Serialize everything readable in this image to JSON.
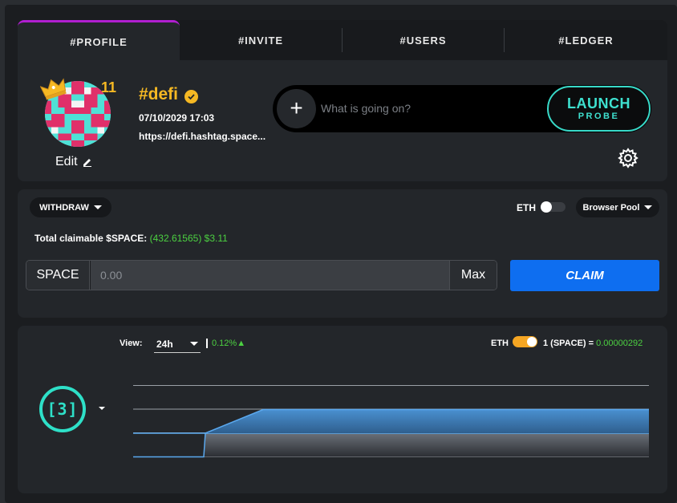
{
  "tabs": [
    {
      "label": "#PROFILE",
      "active": true
    },
    {
      "label": "#INVITE",
      "active": false
    },
    {
      "label": "#USERS",
      "active": false
    },
    {
      "label": "#LEDGER",
      "active": false
    }
  ],
  "profile": {
    "level": "11",
    "edit_label": "Edit",
    "username": "#defi",
    "date": "07/10/2029 17:03",
    "url": "https://defi.hashtag.space..."
  },
  "composer": {
    "placeholder": "What is going on?",
    "plus_label": "+",
    "launch_main": "LAUNCH",
    "launch_sub": "PROBE"
  },
  "claim": {
    "withdraw_label": "WITHDRAW",
    "eth_label": "ETH",
    "pool_label": "Browser Pool",
    "claimable_label": "Total claimable $SPACE:",
    "claimable_amount": "(432.61565)",
    "claimable_usd": "$3.11",
    "currency_label": "SPACE",
    "amount_placeholder": "0.00",
    "max_label": "Max",
    "claim_label": "CLAIM"
  },
  "chart": {
    "view_label": "View:",
    "view_value": "24h",
    "change_pct": "0.12%▲",
    "eth_label": "ETH",
    "rate_label": "1 (SPACE) =",
    "rate_value": "0.00000292",
    "badge_label": "[3]"
  },
  "colors": {
    "accent_purple": "#b01ed0",
    "gold": "#f5b823",
    "teal": "#3ee0cf",
    "claim_blue": "#0e6ef0",
    "positive_green": "#4cd141",
    "toggle_orange": "#f5a623"
  },
  "chart_data": {
    "type": "area",
    "series": [
      {
        "values": [
          0,
          0,
          1,
          1,
          1,
          1
        ]
      },
      {
        "values": [
          1,
          1,
          1,
          2,
          2,
          2
        ]
      }
    ],
    "grid": true
  }
}
